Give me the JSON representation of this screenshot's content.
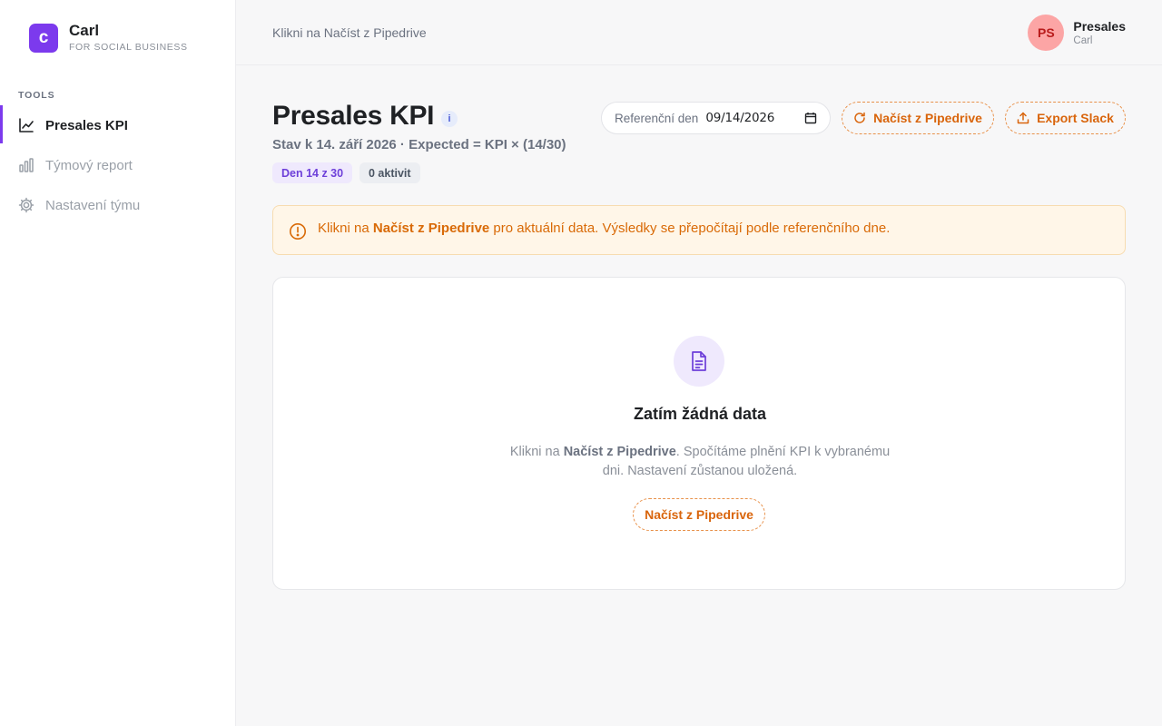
{
  "brand": {
    "logo_letter": "c",
    "name": "Carl",
    "tagline": "FOR SOCIAL BUSINESS"
  },
  "sidebar": {
    "section_label": "TOOLS",
    "items": [
      {
        "label": "Presales KPI",
        "icon": "line-chart-icon",
        "active": true
      },
      {
        "label": "Týmový report",
        "icon": "bar-chart-icon",
        "active": false
      },
      {
        "label": "Nastavení týmu",
        "icon": "gear-icon",
        "active": false
      }
    ]
  },
  "topbar": {
    "breadcrumb": "Klikni na Načíst z Pipedrive",
    "user": {
      "initials": "PS",
      "name": "Presales",
      "role": "Carl"
    }
  },
  "header": {
    "title": "Presales KPI",
    "info_badge": "i",
    "subtitle": "Stav k 14. září 2026 · Expected = KPI × (14/30)",
    "pill_day": "Den 14 z 30",
    "pill_activities": "0 aktivit",
    "date_label": "Referenční den",
    "date_value": "09/14/2026",
    "load_button": "Načíst z Pipedrive",
    "export_button": "Export Slack"
  },
  "alert": {
    "prefix": "Klikni na ",
    "bold": "Načíst z Pipedrive",
    "suffix": " pro aktuální data. Výsledky se přepočítají podle referenčního dne."
  },
  "empty_state": {
    "title": "Zatím žádná data",
    "desc_prefix": "Klikni na ",
    "desc_bold": "Načíst z Pipedrive",
    "desc_suffix": ". Spočítáme plnění KPI k vybranému dni. Nastavení zůstanou uložená.",
    "button": "Načíst z Pipedrive"
  },
  "colors": {
    "accent": "#7c3aed",
    "orange": "#d9650c",
    "alert_bg": "#fff6e8",
    "avatar_bg": "#fca5a5"
  }
}
